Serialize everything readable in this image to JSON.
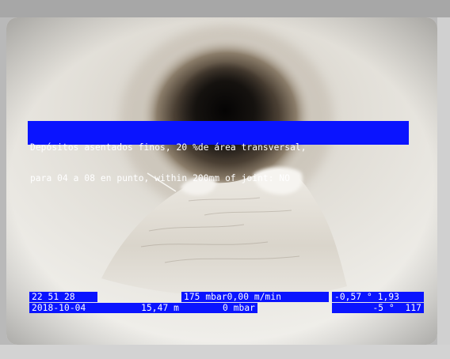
{
  "overlay": {
    "observation_line1": "Depósitos asentados finos, 20 %de área transversal,",
    "observation_line2": "para 04 a 08 en punto, within 200mm of joint: NO",
    "time": "22 51 28",
    "date": "2018-10-04",
    "distance": "15,47 m",
    "pressure_speed": "175 mbar0,00 m/min",
    "pressure2": "0 mbar",
    "inclination1": "-0,57 ° 1,93",
    "inclination2": "-5 °  117"
  },
  "colors": {
    "osd_background": "#0a14ff",
    "osd_text": "#ffffff",
    "pipe_wall": "#e9e7e2",
    "pipe_dark": "#1e1a16"
  }
}
